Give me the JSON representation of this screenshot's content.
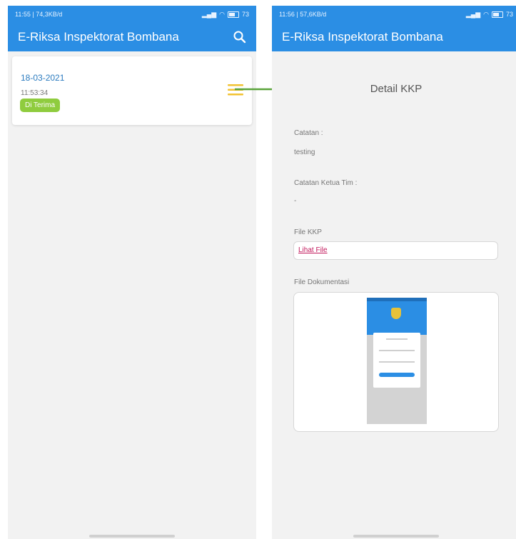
{
  "left_screen": {
    "status": {
      "time": "11:55 | 74,3KB/d",
      "battery": "73"
    },
    "appbar": {
      "title": "E-Riksa Inspektorat Bombana"
    },
    "card": {
      "date": "18-03-2021",
      "time": "11:53:34",
      "badge": "Di Terima"
    }
  },
  "right_screen": {
    "status": {
      "time": "11:56 | 57,6KB/d",
      "battery": "73"
    },
    "appbar": {
      "title": "E-Riksa Inspektorat Bombana"
    },
    "detail": {
      "title": "Detail KKP",
      "catatan_label": "Catatan :",
      "catatan_value": "testing",
      "catatan_ketua_label": "Catatan Ketua Tim :",
      "catatan_ketua_value": "-",
      "file_kkp_label": "File KKP",
      "file_link": "Lihat File",
      "file_dokumentasi_label": "File Dokumentasi"
    }
  },
  "colors": {
    "primary": "#2b8ee4",
    "badge": "#8fcc3e",
    "menu_icon": "#f2c230",
    "arrow": "#5aa33a",
    "link": "#c2185b"
  },
  "icons": {
    "search": "search-icon",
    "menu": "hamburger-menu-icon",
    "arrow": "arrow-right-icon"
  }
}
